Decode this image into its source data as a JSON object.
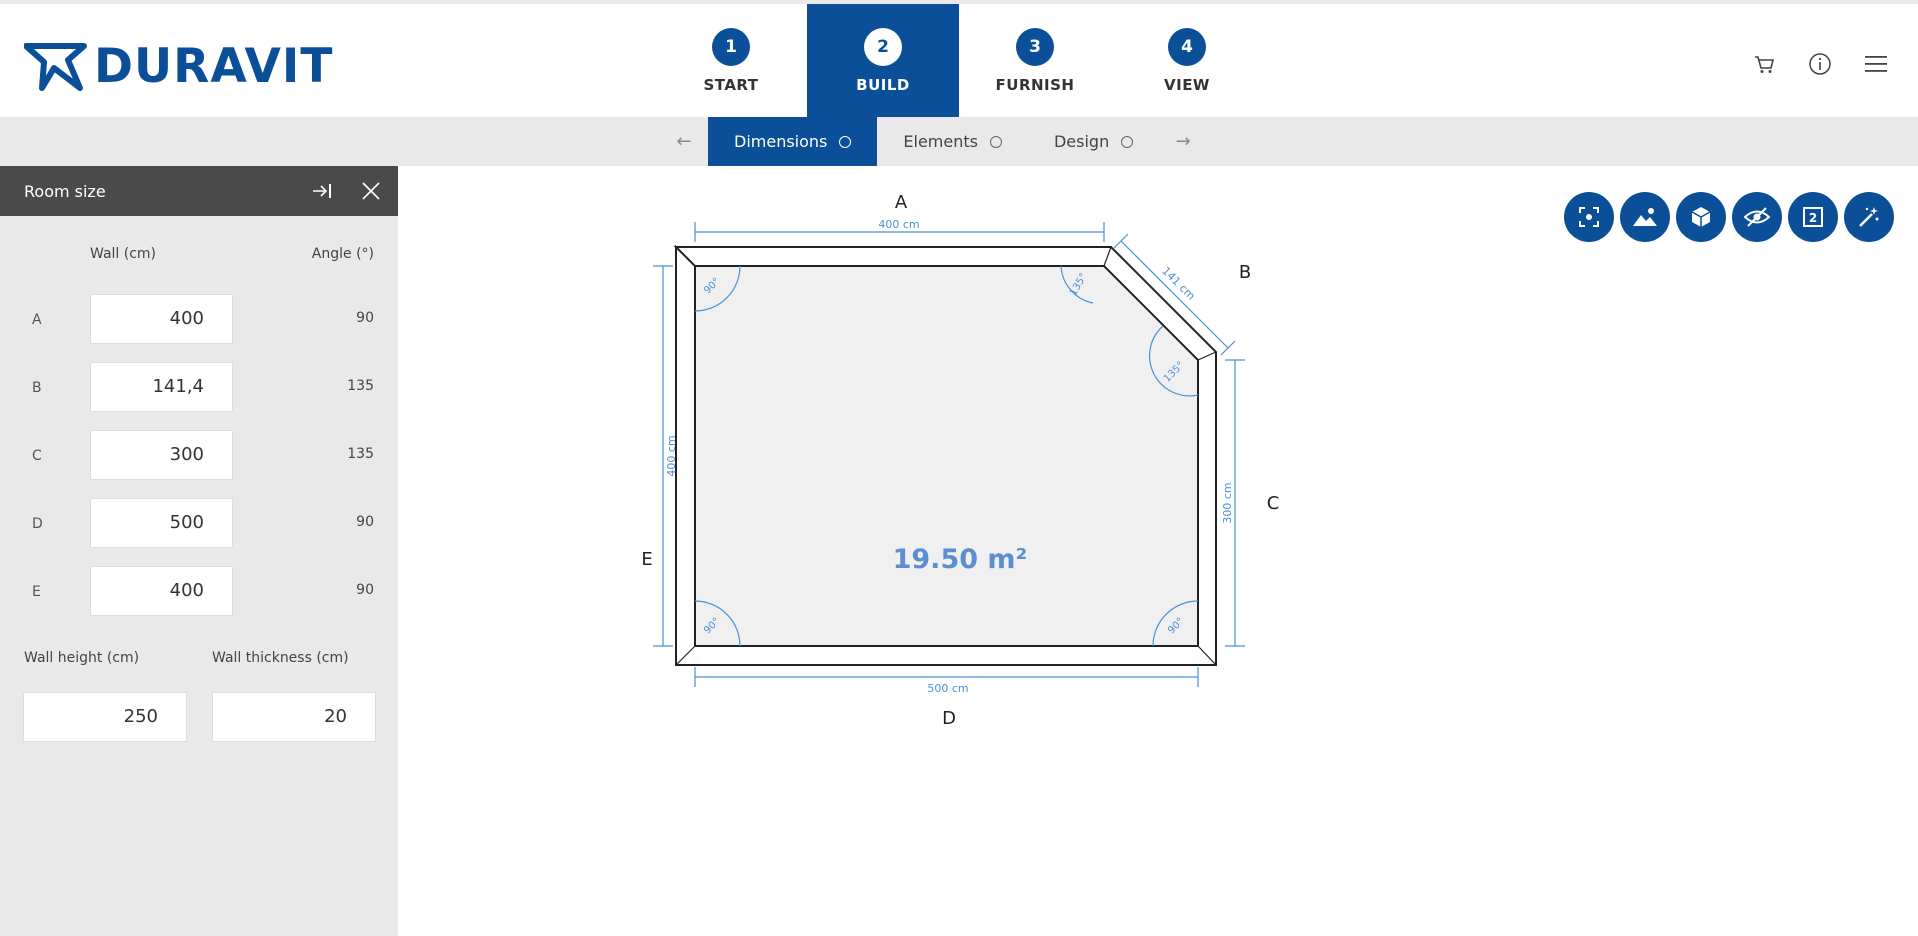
{
  "brand": {
    "name": "DURAVIT",
    "color": "#0a4f97"
  },
  "steps": [
    {
      "num": "1",
      "label": "START",
      "active": false
    },
    {
      "num": "2",
      "label": "BUILD",
      "active": true
    },
    {
      "num": "3",
      "label": "FURNISH",
      "active": false
    },
    {
      "num": "4",
      "label": "VIEW",
      "active": false
    }
  ],
  "header_icons": [
    "cart-icon",
    "info-icon",
    "menu-icon"
  ],
  "subnav": {
    "tabs": [
      {
        "label": "Dimensions",
        "active": true
      },
      {
        "label": "Elements",
        "active": false
      },
      {
        "label": "Design",
        "active": false
      }
    ]
  },
  "sidebar": {
    "title": "Room size",
    "col_wall": "Wall (cm)",
    "col_angle": "Angle (°)",
    "walls": [
      {
        "label": "A",
        "value": "400",
        "angle": "90"
      },
      {
        "label": "B",
        "value": "141,4",
        "angle": "135"
      },
      {
        "label": "C",
        "value": "300",
        "angle": "135"
      },
      {
        "label": "D",
        "value": "500",
        "angle": "90"
      },
      {
        "label": "E",
        "value": "400",
        "angle": "90"
      }
    ],
    "wall_height_label": "Wall height (cm)",
    "wall_height": "250",
    "wall_thickness_label": "Wall thickness (cm)",
    "wall_thickness": "20"
  },
  "toolbar_icons": [
    "fit-view-icon",
    "image-icon",
    "3d-cube-icon",
    "hide-icon",
    "2d-view-icon",
    "magic-wand-icon"
  ],
  "plan": {
    "area": "19.50 m²",
    "wall_labels": {
      "A": "A",
      "B": "B",
      "C": "C",
      "D": "D",
      "E": "E"
    },
    "dims": {
      "A": "400 cm",
      "B": "141 cm",
      "C": "300 cm",
      "D": "500 cm",
      "E": "400 cm"
    },
    "angles": {
      "tl": "90°",
      "tr": "135°",
      "r": "135°",
      "br": "90°",
      "bl": "90°"
    }
  }
}
